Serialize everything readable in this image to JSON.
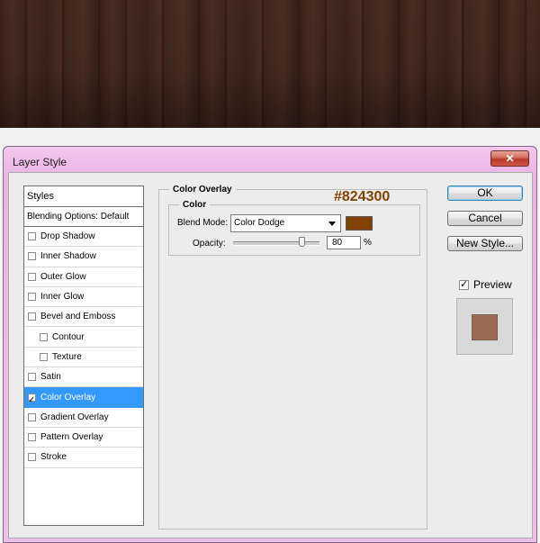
{
  "colors": {
    "overlay": "#824300",
    "preview": "#9b6b55",
    "selected_row": "#3399ff"
  },
  "window": {
    "title": "Layer Style",
    "close_glyph": "✕"
  },
  "styles_panel": {
    "header": "Styles",
    "blending_options": "Blending Options: Default",
    "items": [
      {
        "label": "Drop Shadow",
        "checked": false,
        "indent": false
      },
      {
        "label": "Inner Shadow",
        "checked": false,
        "indent": false
      },
      {
        "label": "Outer Glow",
        "checked": false,
        "indent": false
      },
      {
        "label": "Inner Glow",
        "checked": false,
        "indent": false
      },
      {
        "label": "Bevel and Emboss",
        "checked": false,
        "indent": false
      },
      {
        "label": "Contour",
        "checked": false,
        "indent": true
      },
      {
        "label": "Texture",
        "checked": false,
        "indent": true
      },
      {
        "label": "Satin",
        "checked": false,
        "indent": false
      },
      {
        "label": "Color Overlay",
        "checked": true,
        "indent": false,
        "selected": true
      },
      {
        "label": "Gradient Overlay",
        "checked": false,
        "indent": false
      },
      {
        "label": "Pattern Overlay",
        "checked": false,
        "indent": false
      },
      {
        "label": "Stroke",
        "checked": false,
        "indent": false
      }
    ]
  },
  "color_overlay": {
    "section_title": "Color Overlay",
    "subsection_title": "Color",
    "hex_annotation": "#824300",
    "blend_mode_label": "Blend Mode:",
    "blend_mode_value": "Color Dodge",
    "opacity_label": "Opacity:",
    "opacity_value": "80",
    "opacity_unit": "%",
    "opacity_fraction": 0.8
  },
  "buttons": {
    "ok": "OK",
    "cancel": "Cancel",
    "new_style": "New Style..."
  },
  "preview": {
    "label": "Preview",
    "checked": true
  }
}
